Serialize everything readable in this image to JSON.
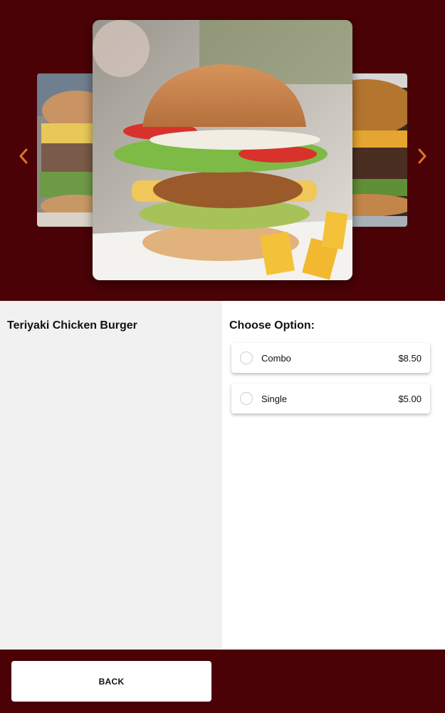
{
  "carousel": {
    "images": [
      {
        "name": "burger-image-previous"
      },
      {
        "name": "burger-image-current"
      },
      {
        "name": "burger-image-next"
      }
    ],
    "arrow_color": "#e0732b"
  },
  "item": {
    "name": "Teriyaki Chicken Burger"
  },
  "options": {
    "title": "Choose Option:",
    "items": [
      {
        "label": "Combo",
        "price": "$8.50",
        "selected": false
      },
      {
        "label": "Single",
        "price": "$5.00",
        "selected": false
      }
    ]
  },
  "footer": {
    "back_label": "BACK"
  },
  "colors": {
    "brand_dark": "#4a0206",
    "panel_gray": "#f1f1f1"
  }
}
